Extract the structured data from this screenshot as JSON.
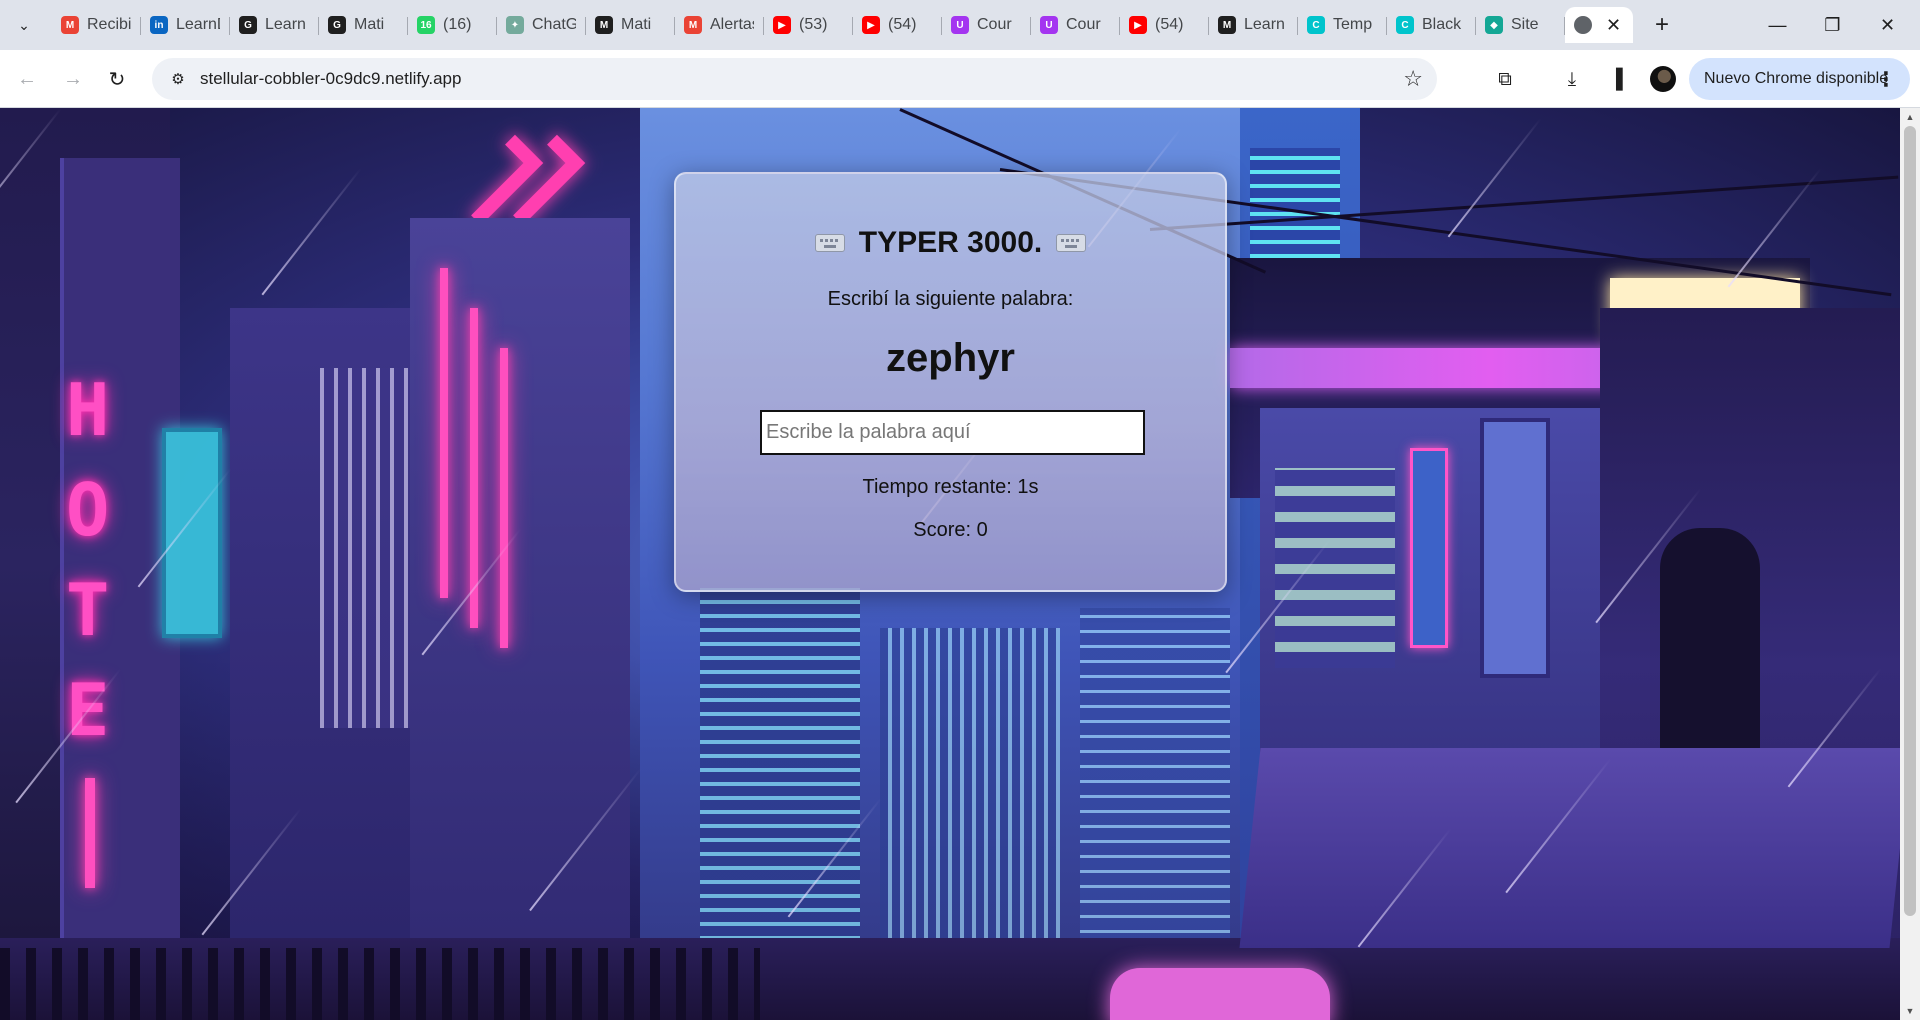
{
  "browser": {
    "tabs": [
      {
        "title": "Recibidos",
        "icon": "gmail-icon",
        "color": "#ea4335",
        "glyph": "M"
      },
      {
        "title": "LearnDash",
        "icon": "linkedin-icon",
        "color": "#0a66c2",
        "glyph": "in"
      },
      {
        "title": "Learn",
        "icon": "github-icon",
        "color": "#1f1f1f",
        "glyph": "G"
      },
      {
        "title": "Mati",
        "icon": "github-icon",
        "color": "#1f1f1f",
        "glyph": "G"
      },
      {
        "title": "(16)",
        "icon": "whatsapp-icon",
        "color": "#25d366",
        "glyph": "16"
      },
      {
        "title": "ChatGPT",
        "icon": "chatgpt-icon",
        "color": "#74aa9c",
        "glyph": "✦"
      },
      {
        "title": "Mati",
        "icon": "medium-icon",
        "color": "#1f1f1f",
        "glyph": "M"
      },
      {
        "title": "Alertas",
        "icon": "gmail-icon",
        "color": "#ea4335",
        "glyph": "M"
      },
      {
        "title": "(53)",
        "icon": "youtube-icon",
        "color": "#ff0000",
        "glyph": "▶"
      },
      {
        "title": "(54)",
        "icon": "youtube-icon",
        "color": "#ff0000",
        "glyph": "▶"
      },
      {
        "title": "Cour",
        "icon": "udemy-icon",
        "color": "#a435f0",
        "glyph": "U"
      },
      {
        "title": "Cour",
        "icon": "udemy-icon",
        "color": "#a435f0",
        "glyph": "U"
      },
      {
        "title": "(54)",
        "icon": "youtube-icon",
        "color": "#ff0000",
        "glyph": "▶"
      },
      {
        "title": "Learn",
        "icon": "medium-icon",
        "color": "#1f1f1f",
        "glyph": "M"
      },
      {
        "title": "Temp",
        "icon": "canva-icon",
        "color": "#00c4cc",
        "glyph": "C"
      },
      {
        "title": "Black",
        "icon": "canva-icon",
        "color": "#00c4cc",
        "glyph": "C"
      },
      {
        "title": "Site",
        "icon": "netlify-icon",
        "color": "#14a795",
        "glyph": "◆"
      }
    ],
    "active_tab": {
      "icon": "globe-icon",
      "close": "✕"
    },
    "url": "stellular-cobbler-0c9dc9.netlify.app",
    "update_chip": "Nuevo Chrome disponible"
  },
  "game": {
    "title": "TYPER 3000.",
    "instruction": "Escribí la siguiente palabra:",
    "word": "zephyr",
    "input_placeholder": "Escribe la palabra aquí",
    "input_value": "",
    "time_label": "Tiempo restante: 1s",
    "score_label": "Score: 0"
  },
  "colors": {
    "tab_strip": "#dfe3eb",
    "omnibox": "#eef1f6",
    "update_chip": "#d3e3fd",
    "neon_pink": "#ff4fc4",
    "card_glass": "rgba(190,200,230,0.78)"
  }
}
